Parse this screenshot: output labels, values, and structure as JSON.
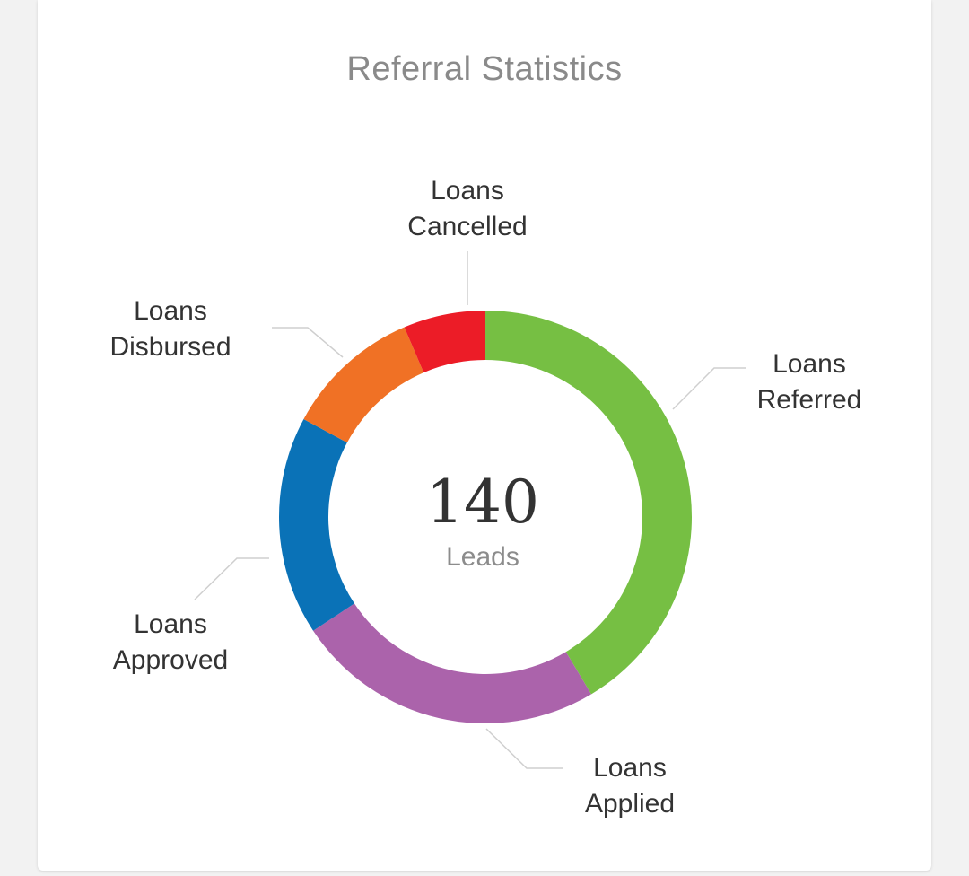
{
  "card": {
    "title": "Referral Statistics"
  },
  "chart_data": {
    "type": "pie",
    "title": "Referral Statistics",
    "total": {
      "value": "140",
      "unit": "Leads"
    },
    "series": [
      {
        "name": "Loans Referred",
        "label_lines": [
          "Loans",
          "Referred"
        ],
        "value": 58,
        "color": "#76bf43"
      },
      {
        "name": "Loans Applied",
        "label_lines": [
          "Loans",
          "Applied"
        ],
        "value": 34,
        "color": "#ab63ab"
      },
      {
        "name": "Loans Approved",
        "label_lines": [
          "Loans",
          "Approved"
        ],
        "value": 24,
        "color": "#0a72b7"
      },
      {
        "name": "Loans Disbursed",
        "label_lines": [
          "Loans",
          "Disbursed"
        ],
        "value": 15,
        "color": "#f07125"
      },
      {
        "name": "Loans Cancelled",
        "label_lines": [
          "Loans",
          "Cancelled"
        ],
        "value": 9,
        "color": "#ec1c27"
      }
    ]
  }
}
